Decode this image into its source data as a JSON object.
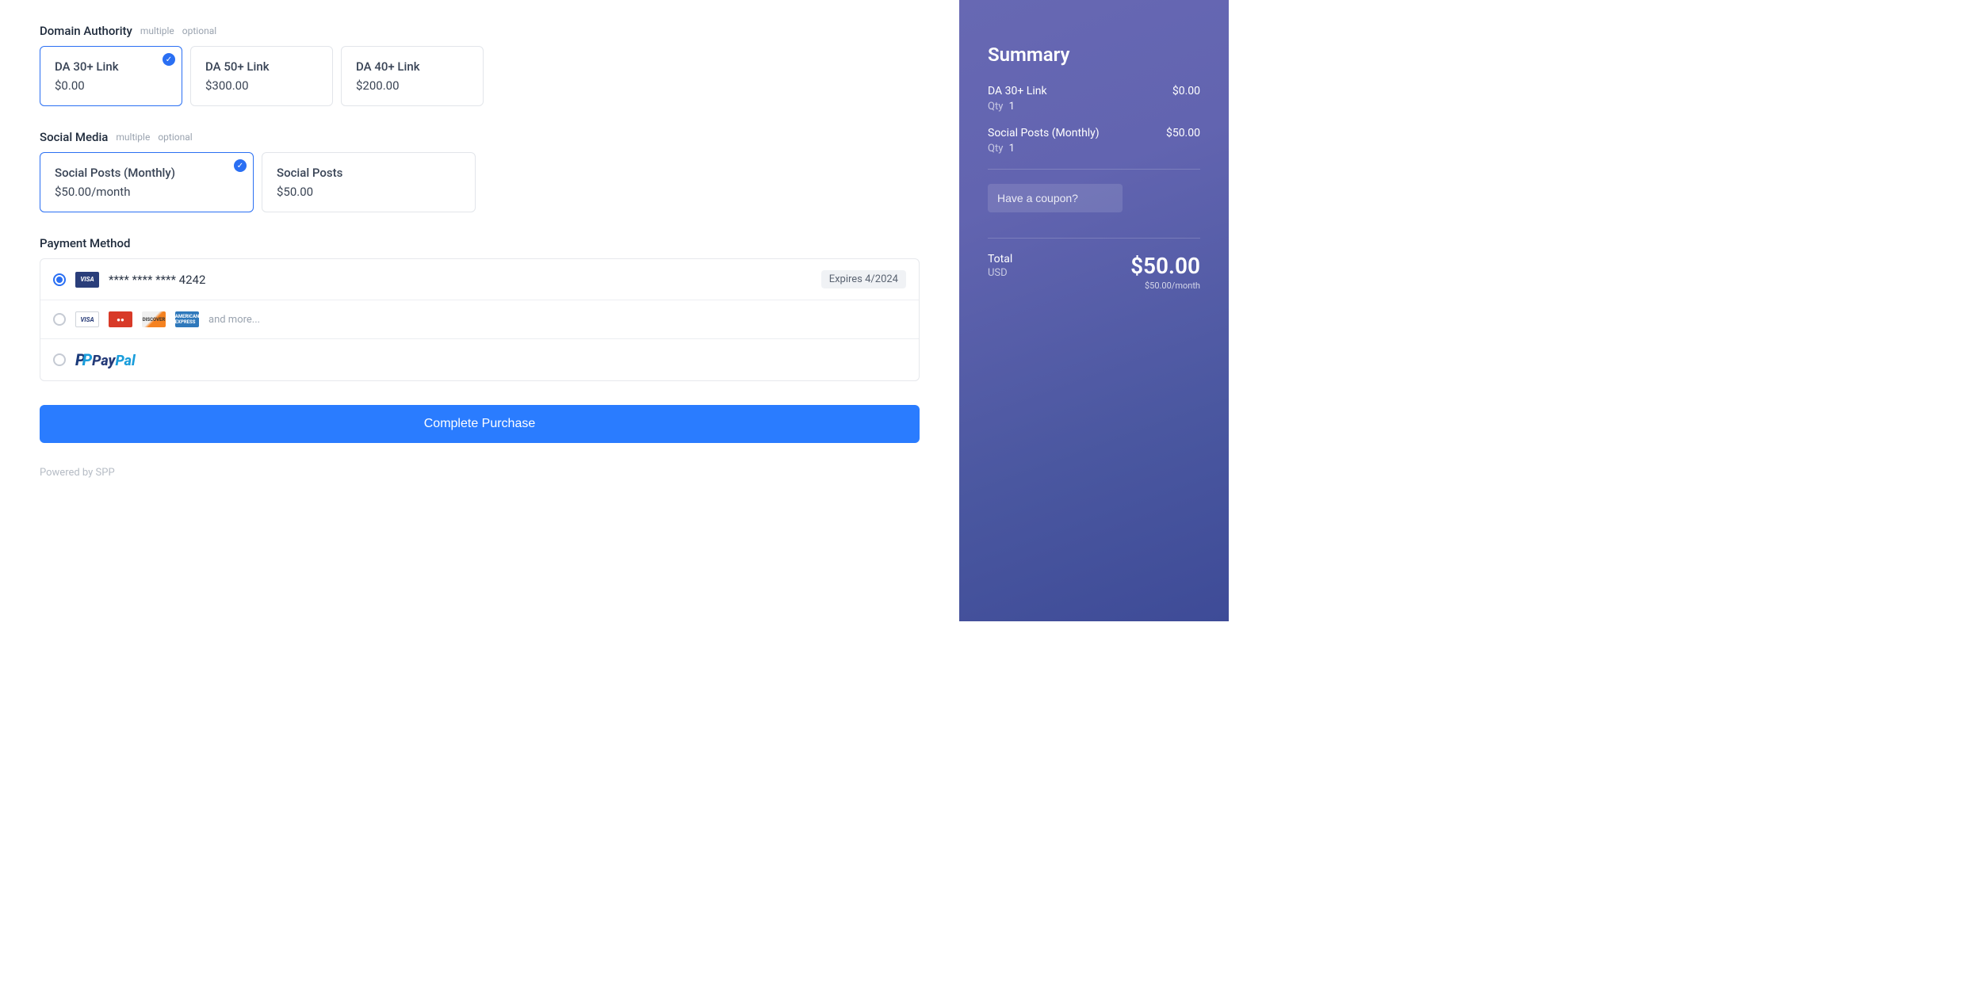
{
  "domain_authority": {
    "title": "Domain Authority",
    "tags": [
      "multiple",
      "optional"
    ],
    "options": [
      {
        "label": "DA 30+ Link",
        "price": "$0.00",
        "selected": true
      },
      {
        "label": "DA 50+ Link",
        "price": "$300.00",
        "selected": false
      },
      {
        "label": "DA 40+ Link",
        "price": "$200.00",
        "selected": false
      }
    ]
  },
  "social_media": {
    "title": "Social Media",
    "tags": [
      "multiple",
      "optional"
    ],
    "options": [
      {
        "label": "Social Posts (Monthly)",
        "price": "$50.00/month",
        "selected": true
      },
      {
        "label": "Social Posts",
        "price": "$50.00",
        "selected": false
      }
    ]
  },
  "payment": {
    "title": "Payment Method",
    "saved_card": {
      "brand": "VISA",
      "masked": "**** **** **** 4242",
      "expires": "Expires 4/2024"
    },
    "other_cards": {
      "brands": [
        "VISA",
        "●●",
        "DISCOVER",
        "AMERICAN EXPRESS"
      ],
      "more": "and more..."
    },
    "paypal": "PayPal"
  },
  "actions": {
    "complete": "Complete Purchase",
    "powered": "Powered by SPP"
  },
  "summary": {
    "title": "Summary",
    "items": [
      {
        "name": "DA 30+ Link",
        "price": "$0.00",
        "qty_label": "Qty",
        "qty": "1"
      },
      {
        "name": "Social Posts (Monthly)",
        "price": "$50.00",
        "qty_label": "Qty",
        "qty": "1"
      }
    ],
    "coupon_placeholder": "Have a coupon?",
    "total_label": "Total",
    "currency": "USD",
    "total": "$50.00",
    "subtotal_note": "$50.00/month"
  }
}
